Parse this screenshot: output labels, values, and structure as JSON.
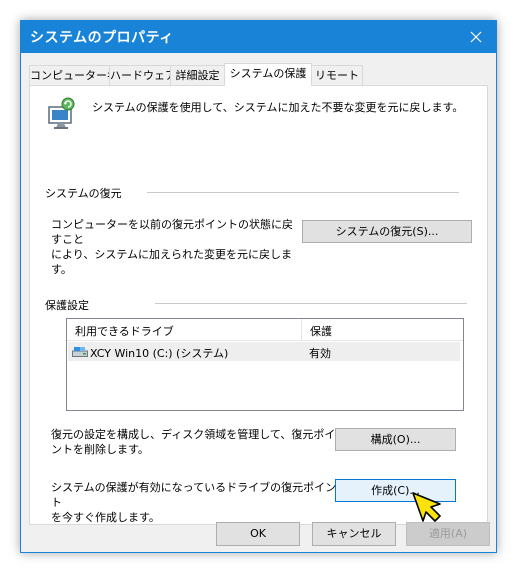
{
  "window": {
    "title": "システムのプロパティ",
    "accent_color": "#1883d7"
  },
  "tabs": [
    {
      "label": "コンピューター名"
    },
    {
      "label": "ハードウェア"
    },
    {
      "label": "詳細設定"
    },
    {
      "label": "システムの保護",
      "active": true
    },
    {
      "label": "リモート"
    }
  ],
  "intro": {
    "icon": "system-protection-icon",
    "text": "システムの保護を使用して、システムに加えた不要な変更を元に戻します。"
  },
  "restore": {
    "heading": "システムの復元",
    "description_line1": "コンピューターを以前の復元ポイントの状態に戻すこと",
    "description_line2": "により、システムに加えられた変更を元に戻します。",
    "button_label": "システムの復元(S)..."
  },
  "protection": {
    "heading": "保護設定",
    "columns": [
      "利用できるドライブ",
      "保護"
    ],
    "drives": [
      {
        "name": "XCY Win10 (C:) (システム)",
        "status": "有効",
        "icon": "drive-icon"
      }
    ],
    "configure": {
      "description_line1": "復元の設定を構成し、ディスク領域を管理して、復元ポイ",
      "description_line2": "ントを削除します。",
      "button_label": "構成(O)..."
    },
    "create": {
      "description_line1": "システムの保護が有効になっているドライブの復元ポイント",
      "description_line2": "を今すぐ作成します。",
      "button_label": "作成(C)..."
    }
  },
  "footer": {
    "ok_label": "OK",
    "cancel_label": "キャンセル",
    "apply_label": "適用(A)"
  }
}
